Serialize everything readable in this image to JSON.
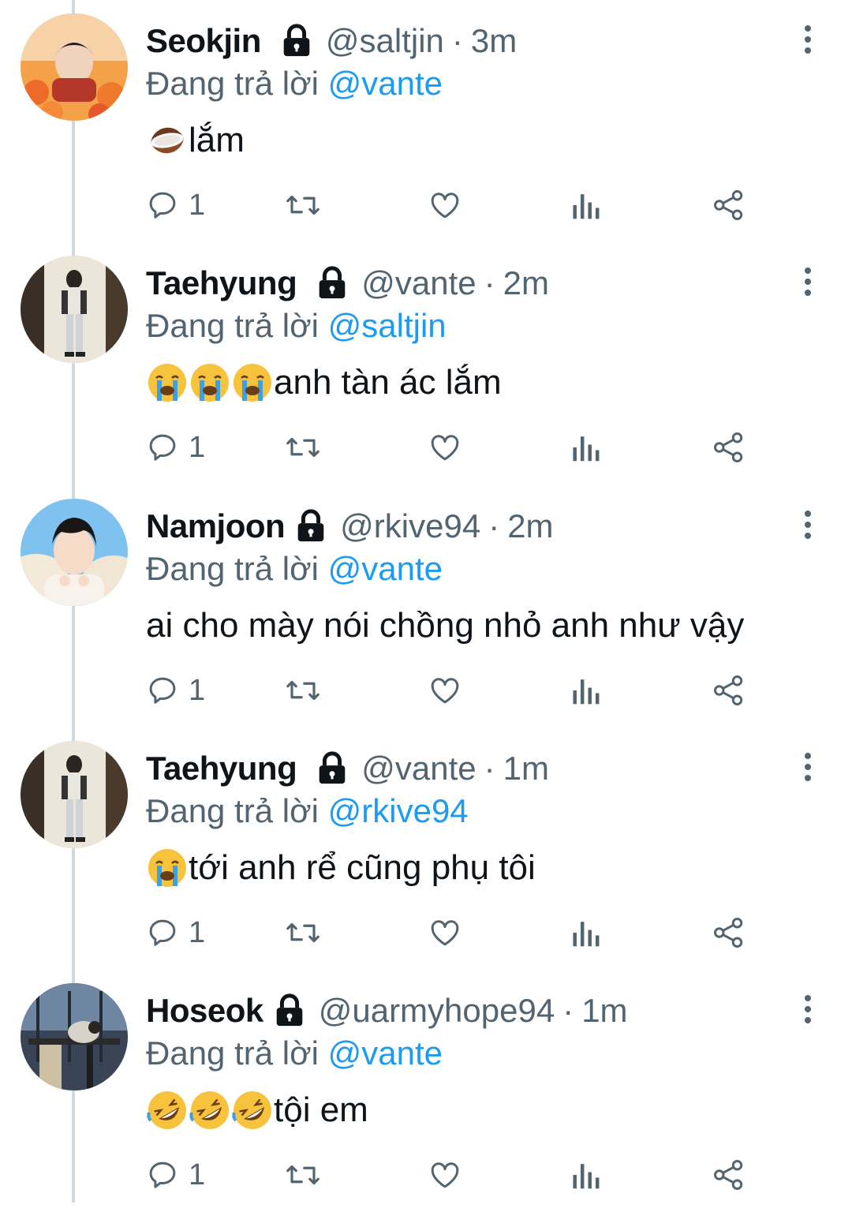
{
  "replying_prefix": "Đang trả lời",
  "colors": {
    "accent": "#1d9bf0",
    "muted": "#536471",
    "text": "#0f1419",
    "thread_line": "#cfd9de"
  },
  "tweets": [
    {
      "name": "Seokjin",
      "handle": "@saltjin",
      "time": "3m",
      "separator": "·",
      "mention": "@vante",
      "text": "lắm",
      "emojis": [
        "coconut-emoji"
      ],
      "reply_count": "1",
      "icons": [
        "reply-icon",
        "retweet-icon",
        "like-icon",
        "analytics-icon",
        "share-icon"
      ]
    },
    {
      "name": "Taehyung",
      "handle": "@vante",
      "time": "2m",
      "separator": "·",
      "mention": "@saltjin",
      "text": "anh tàn ác lắm",
      "emojis": [
        "crying-face-emoji",
        "crying-face-emoji",
        "crying-face-emoji"
      ],
      "reply_count": "1",
      "icons": [
        "reply-icon",
        "retweet-icon",
        "like-icon",
        "analytics-icon",
        "share-icon"
      ]
    },
    {
      "name": "Namjoon",
      "handle": "@rkive94",
      "time": "2m",
      "separator": "·",
      "mention": "@vante",
      "text": "ai cho mày nói chồng nhỏ anh như vậy",
      "emojis": [],
      "reply_count": "1",
      "icons": [
        "reply-icon",
        "retweet-icon",
        "like-icon",
        "analytics-icon",
        "share-icon"
      ]
    },
    {
      "name": "Taehyung",
      "handle": "@vante",
      "time": "1m",
      "separator": "·",
      "mention": "@rkive94",
      "text": "tới anh rể cũng phụ tôi",
      "emojis": [
        "crying-face-emoji"
      ],
      "reply_count": "1",
      "icons": [
        "reply-icon",
        "retweet-icon",
        "like-icon",
        "analytics-icon",
        "share-icon"
      ]
    },
    {
      "name": "Hoseok",
      "handle": "@uarmyhope94",
      "time": "1m",
      "separator": "·",
      "mention": "@vante",
      "text": "tội em",
      "emojis": [
        "rofl-emoji",
        "rofl-emoji",
        "rofl-emoji"
      ],
      "reply_count": "1",
      "icons": [
        "reply-icon",
        "retweet-icon",
        "like-icon",
        "analytics-icon",
        "share-icon"
      ]
    }
  ]
}
